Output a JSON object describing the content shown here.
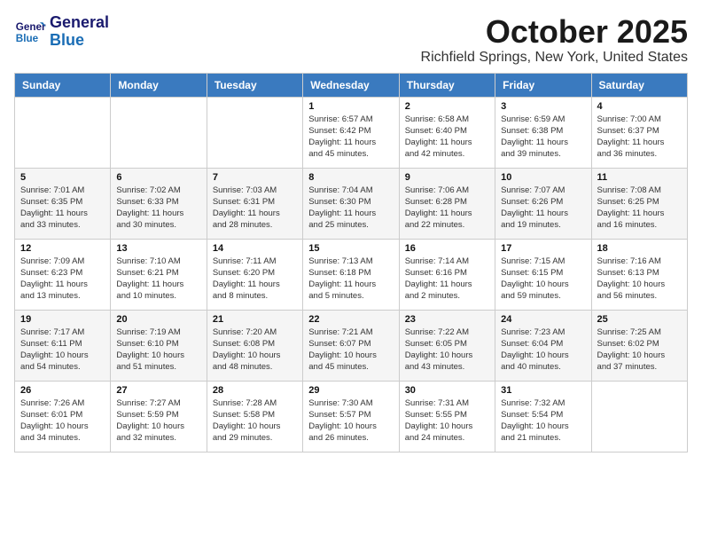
{
  "header": {
    "logo_line1": "General",
    "logo_line2": "Blue",
    "month_title": "October 2025",
    "location": "Richfield Springs, New York, United States"
  },
  "weekdays": [
    "Sunday",
    "Monday",
    "Tuesday",
    "Wednesday",
    "Thursday",
    "Friday",
    "Saturday"
  ],
  "weeks": [
    [
      {
        "day": "",
        "info": ""
      },
      {
        "day": "",
        "info": ""
      },
      {
        "day": "",
        "info": ""
      },
      {
        "day": "1",
        "info": "Sunrise: 6:57 AM\nSunset: 6:42 PM\nDaylight: 11 hours\nand 45 minutes."
      },
      {
        "day": "2",
        "info": "Sunrise: 6:58 AM\nSunset: 6:40 PM\nDaylight: 11 hours\nand 42 minutes."
      },
      {
        "day": "3",
        "info": "Sunrise: 6:59 AM\nSunset: 6:38 PM\nDaylight: 11 hours\nand 39 minutes."
      },
      {
        "day": "4",
        "info": "Sunrise: 7:00 AM\nSunset: 6:37 PM\nDaylight: 11 hours\nand 36 minutes."
      }
    ],
    [
      {
        "day": "5",
        "info": "Sunrise: 7:01 AM\nSunset: 6:35 PM\nDaylight: 11 hours\nand 33 minutes."
      },
      {
        "day": "6",
        "info": "Sunrise: 7:02 AM\nSunset: 6:33 PM\nDaylight: 11 hours\nand 30 minutes."
      },
      {
        "day": "7",
        "info": "Sunrise: 7:03 AM\nSunset: 6:31 PM\nDaylight: 11 hours\nand 28 minutes."
      },
      {
        "day": "8",
        "info": "Sunrise: 7:04 AM\nSunset: 6:30 PM\nDaylight: 11 hours\nand 25 minutes."
      },
      {
        "day": "9",
        "info": "Sunrise: 7:06 AM\nSunset: 6:28 PM\nDaylight: 11 hours\nand 22 minutes."
      },
      {
        "day": "10",
        "info": "Sunrise: 7:07 AM\nSunset: 6:26 PM\nDaylight: 11 hours\nand 19 minutes."
      },
      {
        "day": "11",
        "info": "Sunrise: 7:08 AM\nSunset: 6:25 PM\nDaylight: 11 hours\nand 16 minutes."
      }
    ],
    [
      {
        "day": "12",
        "info": "Sunrise: 7:09 AM\nSunset: 6:23 PM\nDaylight: 11 hours\nand 13 minutes."
      },
      {
        "day": "13",
        "info": "Sunrise: 7:10 AM\nSunset: 6:21 PM\nDaylight: 11 hours\nand 10 minutes."
      },
      {
        "day": "14",
        "info": "Sunrise: 7:11 AM\nSunset: 6:20 PM\nDaylight: 11 hours\nand 8 minutes."
      },
      {
        "day": "15",
        "info": "Sunrise: 7:13 AM\nSunset: 6:18 PM\nDaylight: 11 hours\nand 5 minutes."
      },
      {
        "day": "16",
        "info": "Sunrise: 7:14 AM\nSunset: 6:16 PM\nDaylight: 11 hours\nand 2 minutes."
      },
      {
        "day": "17",
        "info": "Sunrise: 7:15 AM\nSunset: 6:15 PM\nDaylight: 10 hours\nand 59 minutes."
      },
      {
        "day": "18",
        "info": "Sunrise: 7:16 AM\nSunset: 6:13 PM\nDaylight: 10 hours\nand 56 minutes."
      }
    ],
    [
      {
        "day": "19",
        "info": "Sunrise: 7:17 AM\nSunset: 6:11 PM\nDaylight: 10 hours\nand 54 minutes."
      },
      {
        "day": "20",
        "info": "Sunrise: 7:19 AM\nSunset: 6:10 PM\nDaylight: 10 hours\nand 51 minutes."
      },
      {
        "day": "21",
        "info": "Sunrise: 7:20 AM\nSunset: 6:08 PM\nDaylight: 10 hours\nand 48 minutes."
      },
      {
        "day": "22",
        "info": "Sunrise: 7:21 AM\nSunset: 6:07 PM\nDaylight: 10 hours\nand 45 minutes."
      },
      {
        "day": "23",
        "info": "Sunrise: 7:22 AM\nSunset: 6:05 PM\nDaylight: 10 hours\nand 43 minutes."
      },
      {
        "day": "24",
        "info": "Sunrise: 7:23 AM\nSunset: 6:04 PM\nDaylight: 10 hours\nand 40 minutes."
      },
      {
        "day": "25",
        "info": "Sunrise: 7:25 AM\nSunset: 6:02 PM\nDaylight: 10 hours\nand 37 minutes."
      }
    ],
    [
      {
        "day": "26",
        "info": "Sunrise: 7:26 AM\nSunset: 6:01 PM\nDaylight: 10 hours\nand 34 minutes."
      },
      {
        "day": "27",
        "info": "Sunrise: 7:27 AM\nSunset: 5:59 PM\nDaylight: 10 hours\nand 32 minutes."
      },
      {
        "day": "28",
        "info": "Sunrise: 7:28 AM\nSunset: 5:58 PM\nDaylight: 10 hours\nand 29 minutes."
      },
      {
        "day": "29",
        "info": "Sunrise: 7:30 AM\nSunset: 5:57 PM\nDaylight: 10 hours\nand 26 minutes."
      },
      {
        "day": "30",
        "info": "Sunrise: 7:31 AM\nSunset: 5:55 PM\nDaylight: 10 hours\nand 24 minutes."
      },
      {
        "day": "31",
        "info": "Sunrise: 7:32 AM\nSunset: 5:54 PM\nDaylight: 10 hours\nand 21 minutes."
      },
      {
        "day": "",
        "info": ""
      }
    ]
  ]
}
